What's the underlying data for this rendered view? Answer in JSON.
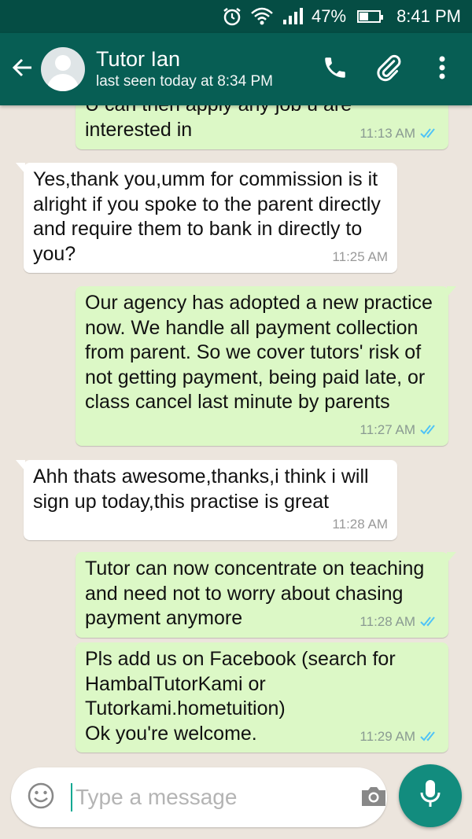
{
  "status_bar": {
    "battery": "47%",
    "time": "8:41 PM",
    "battery_level": 0.47
  },
  "header": {
    "contact_name": "Tutor Ian",
    "last_seen": "last seen today at 8:34 PM"
  },
  "messages": [
    {
      "direction": "out",
      "text": "U can then apply any job u are interested in",
      "time": "11:13 AM",
      "read": true
    },
    {
      "direction": "in",
      "text": "Yes,thank you,umm for commission is it alright if you spoke to the parent directly and require them to bank in directly to you?",
      "time": "11:25 AM"
    },
    {
      "direction": "out",
      "text": "Our agency has adopted a new practice now. We handle all payment collection from parent. So we cover tutors' risk of not getting payment, being paid late, or class cancel last minute by parents",
      "time": "11:27 AM",
      "read": true
    },
    {
      "direction": "in",
      "text": "Ahh thats awesome,thanks,i think i will sign up today,this practise is great",
      "time": "11:28 AM"
    },
    {
      "direction": "out",
      "text": "Tutor can now concentrate on teaching and need not to worry about chasing payment anymore",
      "time": "11:28 AM",
      "read": true
    },
    {
      "direction": "out",
      "text": "Pls add us on Facebook (search for HambalTutorKami or Tutorkami.hometuition)\nOk you're welcome.",
      "time": "11:29 AM",
      "read": true
    }
  ],
  "composer": {
    "placeholder": "Type a message"
  },
  "colors": {
    "header": "#075e54",
    "status_bar": "#054d44",
    "outgoing_bubble": "#dcf8c6",
    "incoming_bubble": "#ffffff",
    "read_ticks": "#4fc3f7",
    "mic_button": "#128c7e"
  },
  "icons": [
    "alarm-icon",
    "wifi-icon",
    "signal-icon",
    "battery-icon",
    "back-arrow-icon",
    "phone-icon",
    "paperclip-icon",
    "more-vert-icon",
    "emoji-icon",
    "camera-icon",
    "mic-icon",
    "double-check-icon"
  ]
}
